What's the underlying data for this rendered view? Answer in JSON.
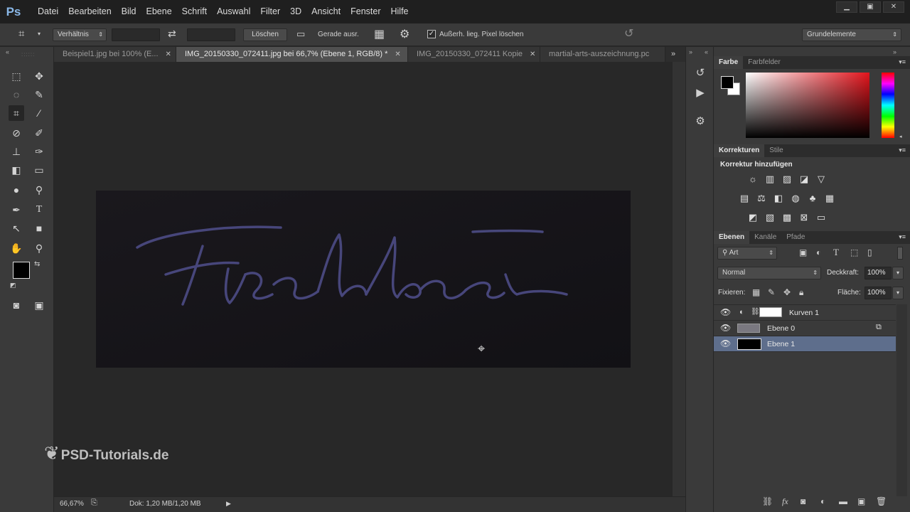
{
  "app": {
    "logo": "Ps"
  },
  "menu": [
    "Datei",
    "Bearbeiten",
    "Bild",
    "Ebene",
    "Schrift",
    "Auswahl",
    "Filter",
    "3D",
    "Ansicht",
    "Fenster",
    "Hilfe"
  ],
  "window_controls": {
    "minimize": "▁",
    "restore": "▣",
    "close": "✕"
  },
  "options": {
    "ratio_label": "Verhältnis",
    "delete_label": "Löschen",
    "straighten_label": "Gerade ausr.",
    "delete_pixels_label": "Außerh. lieg. Pixel löschen",
    "delete_pixels_checked": true,
    "workspace": "Grundelemente"
  },
  "tabs": [
    {
      "label": "Beispiel1.jpg bei 100% (E...",
      "active": false
    },
    {
      "label": "IMG_20150330_072411.jpg bei 66,7% (Ebene 1, RGB/8) *",
      "active": true
    },
    {
      "label": "IMG_20150330_072411 Kopie",
      "active": false
    },
    {
      "label": "martial-arts-auszeichnung.pc",
      "active": false
    }
  ],
  "canvas": {
    "image_text": "Fischkasi",
    "watermark": "PSD-Tutorials.de"
  },
  "status": {
    "zoom": "66,67%",
    "doc": "Dok: 1,20 MB/1,20 MB"
  },
  "panels": {
    "color_tabs": [
      "Farbe",
      "Farbfelder"
    ],
    "adjust_tabs": [
      "Korrekturen",
      "Stile"
    ],
    "adjust_title": "Korrektur hinzufügen",
    "layers_tabs": [
      "Ebenen",
      "Kanäle",
      "Pfade"
    ],
    "filter_label": "Art",
    "blend_mode": "Normal",
    "opacity_label": "Deckkraft:",
    "opacity_value": "100%",
    "lock_label": "Fixieren:",
    "fill_label": "Fläche:",
    "fill_value": "100%"
  },
  "layers": [
    {
      "name": "Kurven 1",
      "type": "adjustment"
    },
    {
      "name": "Ebene 0",
      "type": "smart"
    },
    {
      "name": "Ebene 1",
      "type": "normal",
      "selected": true
    }
  ],
  "colors": {
    "accent": "#5e6e8c",
    "handwriting": "#4a4a8c",
    "foreground": "#000000",
    "background": "#ffffff"
  }
}
